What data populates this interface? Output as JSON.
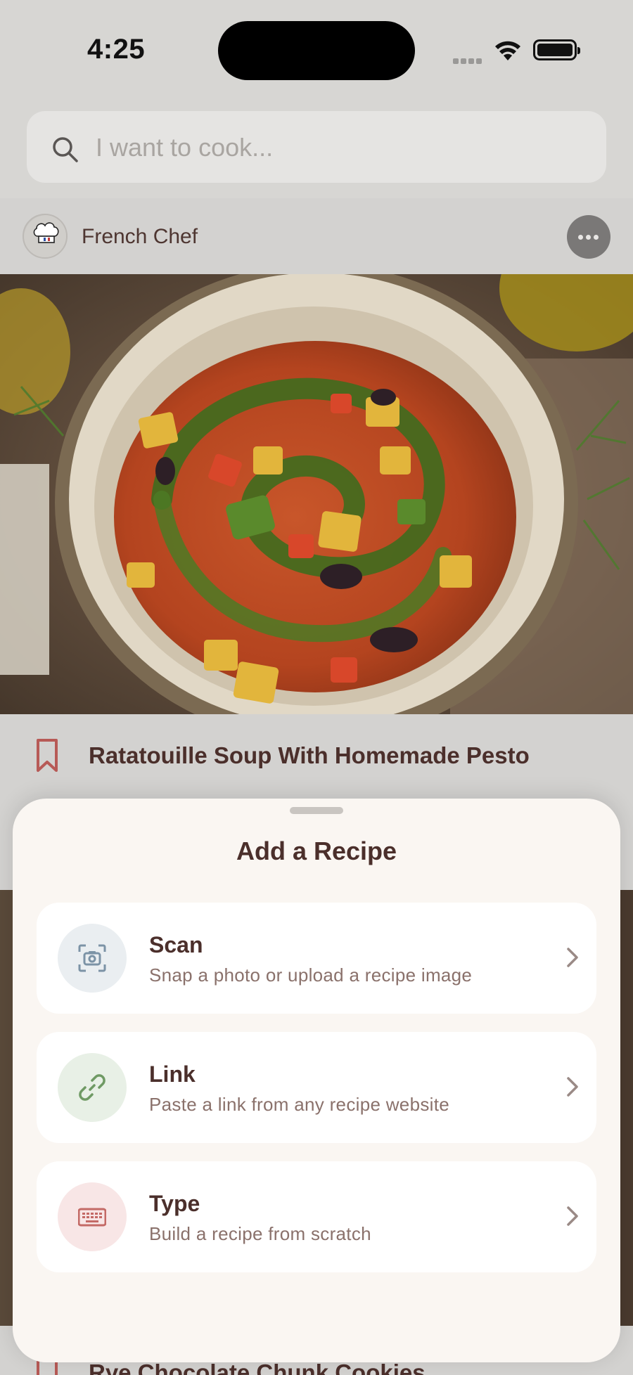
{
  "status_bar": {
    "time": "4:25"
  },
  "search": {
    "placeholder": "I want to cook..."
  },
  "author": {
    "name": "French Chef",
    "avatar_text_line1": "FRENCH",
    "avatar_text_line2": "CHEF"
  },
  "feed": {
    "recipe_title": "Ratatouille Soup With Homemade Pesto",
    "next_recipe_title": "Rye Chocolate Chunk Cookies"
  },
  "sheet": {
    "title": "Add a Recipe",
    "options": [
      {
        "label": "Scan",
        "description": "Snap a photo or upload a recipe image",
        "icon": "camera-scan-icon",
        "icon_bg": "#eaeef1",
        "icon_color": "#7c93a6"
      },
      {
        "label": "Link",
        "description": "Paste a link from any recipe website",
        "icon": "link-icon",
        "icon_bg": "#e8f0e6",
        "icon_color": "#6f9a64"
      },
      {
        "label": "Type",
        "description": "Build a recipe from scratch",
        "icon": "keyboard-icon",
        "icon_bg": "#f8e6e6",
        "icon_color": "#c46a66"
      }
    ]
  },
  "colors": {
    "accent": "#b75a56",
    "title": "#4b2f2b",
    "sheet_bg": "#faf6f2"
  }
}
